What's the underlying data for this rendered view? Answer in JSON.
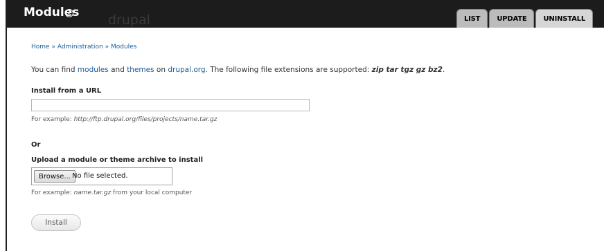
{
  "header": {
    "title": "Modules",
    "watermark": "drupal",
    "tabs": [
      "LIST",
      "UPDATE",
      "UNINSTALL"
    ]
  },
  "breadcrumb": {
    "items": [
      "Home",
      "Administration",
      "Modules"
    ],
    "separator": "»"
  },
  "help": {
    "prefix": "You can find ",
    "link1": "modules",
    "and": " and ",
    "link2": "themes",
    "on": " on ",
    "link3": "drupal.org",
    "suffix": ". The following file extensions are supported: ",
    "extensions": "zip tar tgz gz bz2",
    "end": "."
  },
  "url_section": {
    "label": "Install from a URL",
    "value": "",
    "desc_prefix": "For example: ",
    "desc_example": "http://ftp.drupal.org/files/projects/name.tar.gz"
  },
  "or_label": "Or",
  "upload_section": {
    "label": "Upload a module or theme archive to install",
    "browse_label": "Browse...",
    "no_file": "No file selected.",
    "desc_prefix": "For example: ",
    "desc_example": "name.tar.gz",
    "desc_suffix": " from your local computer"
  },
  "install_button": "Install"
}
